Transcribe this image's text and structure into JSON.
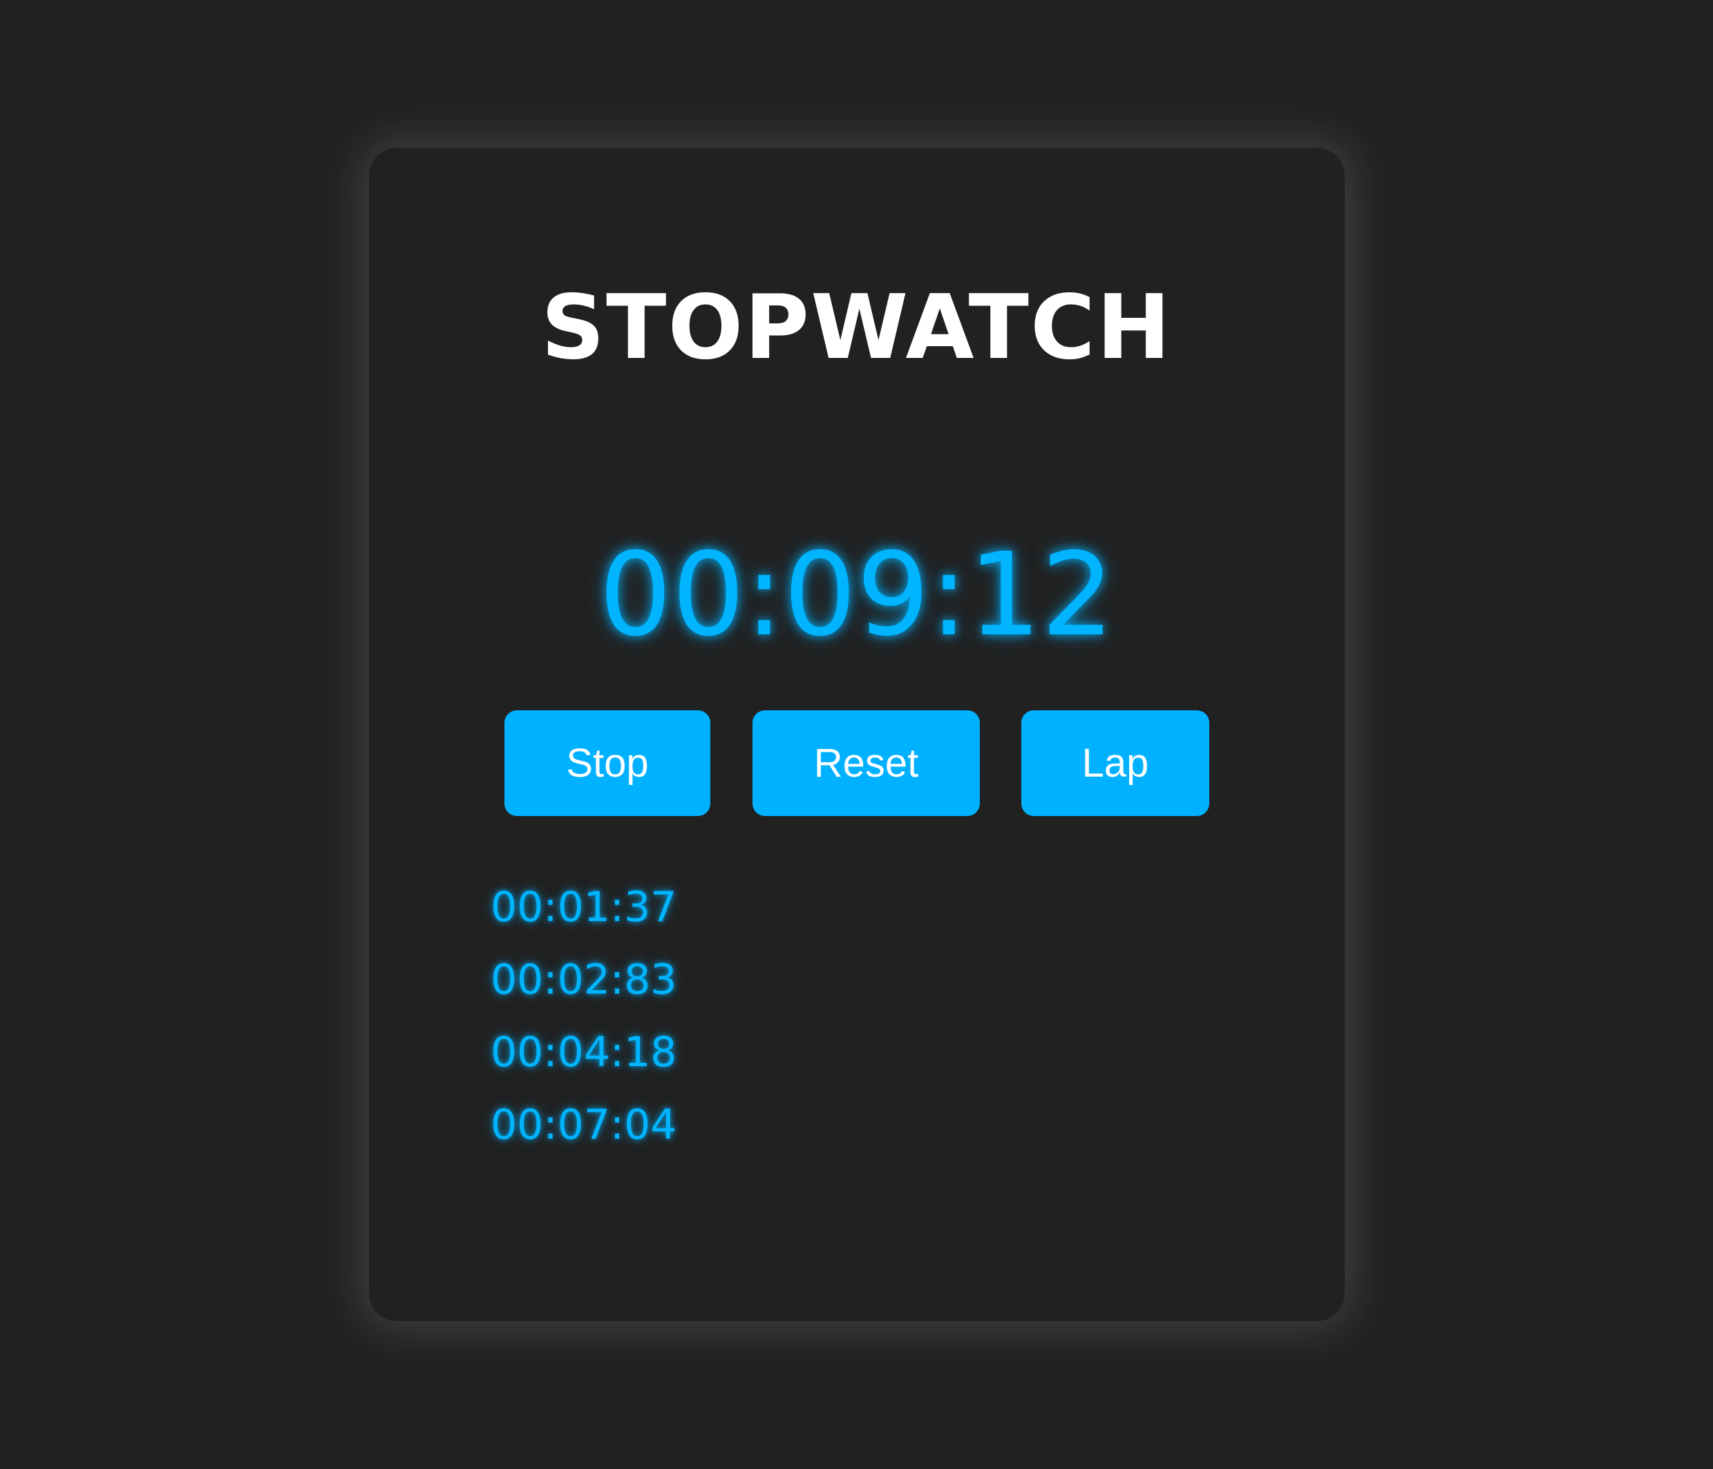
{
  "app": {
    "title": "STOPWATCH"
  },
  "timer": {
    "display": "00:09:12"
  },
  "controls": {
    "stop_label": "Stop",
    "reset_label": "Reset",
    "lap_label": "Lap"
  },
  "laps": [
    "00:01:37",
    "00:02:83",
    "00:04:18",
    "00:07:04"
  ],
  "colors": {
    "background": "#222222",
    "card": "#212121",
    "accent": "#00b1ff",
    "glow_text": "#00b4ff",
    "title_text": "#ffffff"
  }
}
